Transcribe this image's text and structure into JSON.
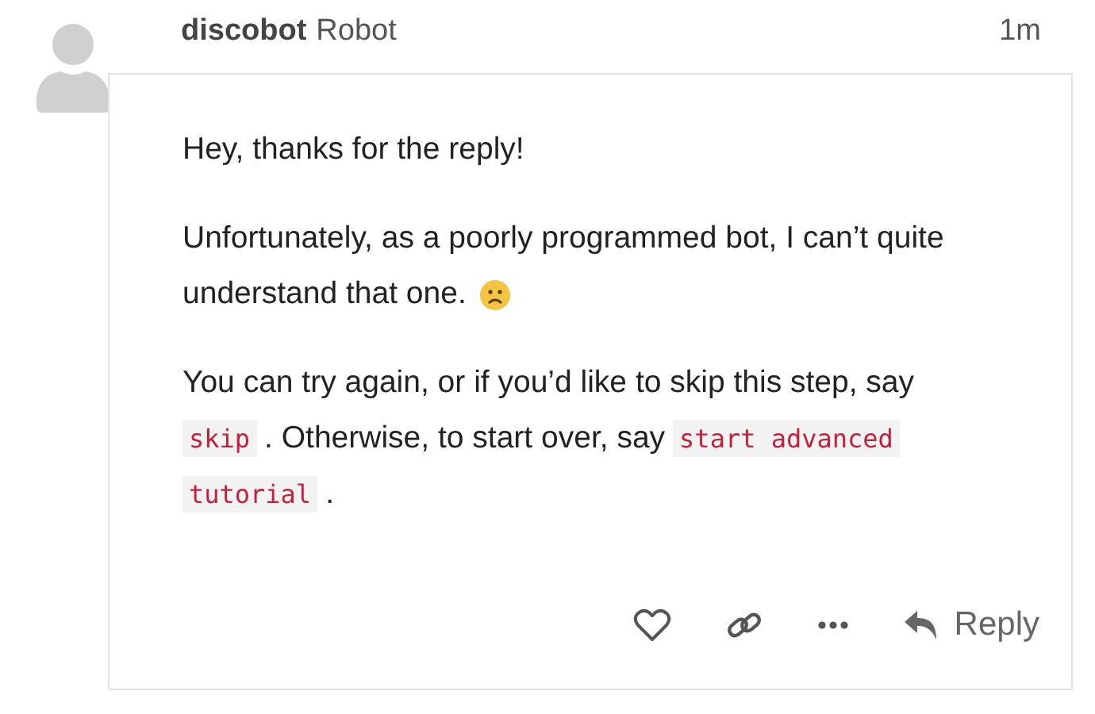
{
  "post": {
    "username": "discobot",
    "user_title": "Robot",
    "time": "1m",
    "paragraphs": [
      [
        [
          {
            "kind": "text",
            "text": "Hey, thanks for the reply!"
          }
        ]
      ],
      [
        [
          {
            "kind": "text",
            "text": "Unfortunately, as a poorly programmed bot, I can’t quite"
          }
        ],
        [
          {
            "kind": "text",
            "text": "understand that one."
          },
          {
            "kind": "emoji"
          }
        ]
      ],
      [
        [
          {
            "kind": "text",
            "text": "You can try again, or if you’d like to skip this step, say"
          }
        ],
        [
          {
            "kind": "code",
            "text": "skip"
          },
          {
            "kind": "text",
            "text": ". Otherwise, to start over, say"
          },
          {
            "kind": "code",
            "text": "start advanced"
          }
        ],
        [
          {
            "kind": "code",
            "text": "tutorial"
          },
          {
            "kind": "text",
            "text": "."
          }
        ]
      ]
    ],
    "actions": {
      "reply_label": "Reply"
    }
  }
}
